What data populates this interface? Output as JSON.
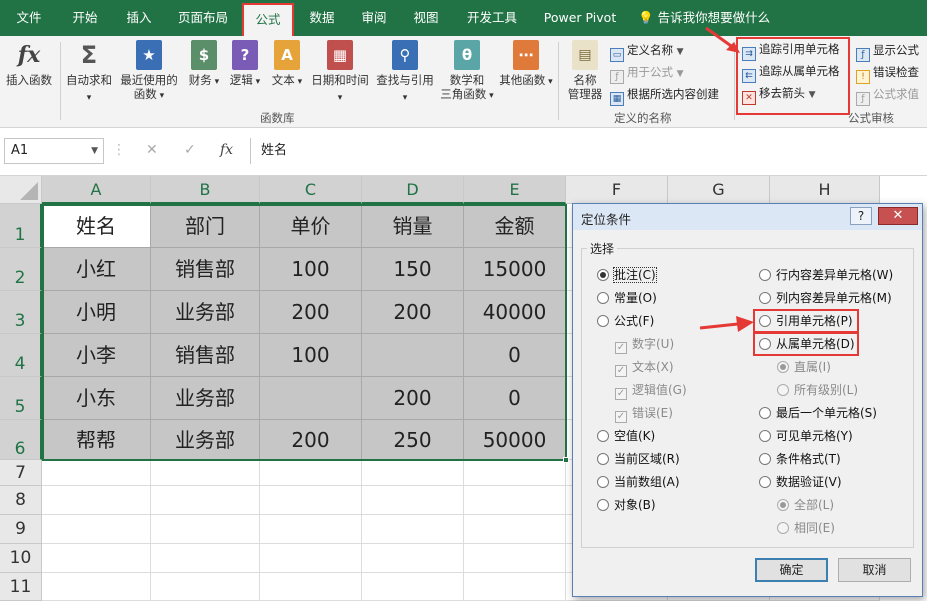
{
  "menu": {
    "tabs": [
      "文件",
      "开始",
      "插入",
      "页面布局",
      "公式",
      "数据",
      "审阅",
      "视图",
      "开发工具",
      "Power Pivot"
    ],
    "active_tab": "公式",
    "tell_me": "告诉我你想要做什么"
  },
  "ribbon": {
    "insert_function": "插入函数",
    "library": [
      {
        "line1": "自动求和",
        "line2": "",
        "icon": "Σ",
        "icon_name": "sum-icon",
        "color": "#555555"
      },
      {
        "line1": "最近使用的",
        "line2": "函数",
        "icon": "★",
        "icon_name": "star-book-icon",
        "color": "#3a6fb5"
      },
      {
        "line1": "财务",
        "line2": "",
        "icon": "$",
        "icon_name": "coins-book-icon",
        "color": "#5a8f6a"
      },
      {
        "line1": "逻辑",
        "line2": "",
        "icon": "?",
        "icon_name": "question-book-icon",
        "color": "#7a5bb5"
      },
      {
        "line1": "文本",
        "line2": "",
        "icon": "A",
        "icon_name": "text-book-icon",
        "color": "#e6a33a"
      },
      {
        "line1": "日期和时间",
        "line2": "",
        "icon": "▦",
        "icon_name": "calendar-book-icon",
        "color": "#c0504d"
      },
      {
        "line1": "查找与引用",
        "line2": "",
        "icon": "⚲",
        "icon_name": "search-book-icon",
        "color": "#3a6fb5"
      },
      {
        "line1": "数学和",
        "line2": "三角函数",
        "icon": "θ",
        "icon_name": "theta-book-icon",
        "color": "#5aa5a5"
      },
      {
        "line1": "其他函数",
        "line2": "",
        "icon": "⋯",
        "icon_name": "more-book-icon",
        "color": "#e07a3a"
      }
    ],
    "library_label": "函数库",
    "name_manager": [
      "名称",
      "管理器"
    ],
    "define_name": "定义名称",
    "use_in_formula": "用于公式",
    "create_from_selection": "根据所选内容创建",
    "names_label": "定义的名称",
    "trace_precedents": "追踪引用单元格",
    "trace_dependents": "追踪从属单元格",
    "remove_arrows": "移去箭头",
    "show_formulas": "显示公式",
    "error_checking": "错误检查",
    "evaluate_formula": "公式求值",
    "audit_label": "公式审核"
  },
  "formula_bar": {
    "name_box": "A1",
    "fx": "fx",
    "formula": "姓名"
  },
  "sheet": {
    "columns": [
      "A",
      "B",
      "C",
      "D",
      "E",
      "F",
      "G",
      "H"
    ],
    "rows": [
      "1",
      "2",
      "3",
      "4",
      "5",
      "6",
      "7",
      "8",
      "9",
      "10",
      "11"
    ],
    "cells": [
      [
        "姓名",
        "部门",
        "单价",
        "销量",
        "金额"
      ],
      [
        "小红",
        "销售部",
        "100",
        "150",
        "15000"
      ],
      [
        "小明",
        "业务部",
        "200",
        "200",
        "40000"
      ],
      [
        "小李",
        "销售部",
        "100",
        "",
        "0"
      ],
      [
        "小东",
        "业务部",
        "",
        "200",
        "0"
      ],
      [
        "帮帮",
        "业务部",
        "200",
        "250",
        "50000"
      ]
    ]
  },
  "dialog": {
    "title": "定位条件",
    "help": "?",
    "close": "✕",
    "group": "选择",
    "left_options": [
      {
        "label": "批注(C)",
        "kind": "radio",
        "checked": true,
        "disabled": false
      },
      {
        "label": "常量(O)",
        "kind": "radio",
        "checked": false,
        "disabled": false
      },
      {
        "label": "公式(F)",
        "kind": "radio",
        "checked": false,
        "disabled": false
      },
      {
        "label": "数字(U)",
        "kind": "check",
        "checked": true,
        "disabled": true
      },
      {
        "label": "文本(X)",
        "kind": "check",
        "checked": true,
        "disabled": true
      },
      {
        "label": "逻辑值(G)",
        "kind": "check",
        "checked": true,
        "disabled": true
      },
      {
        "label": "错误(E)",
        "kind": "check",
        "checked": true,
        "disabled": true
      },
      {
        "label": "空值(K)",
        "kind": "radio",
        "checked": false,
        "disabled": false
      },
      {
        "label": "当前区域(R)",
        "kind": "radio",
        "checked": false,
        "disabled": false
      },
      {
        "label": "当前数组(A)",
        "kind": "radio",
        "checked": false,
        "disabled": false
      },
      {
        "label": "对象(B)",
        "kind": "radio",
        "checked": false,
        "disabled": false
      }
    ],
    "right_options": [
      {
        "label": "行内容差异单元格(W)",
        "kind": "radio",
        "checked": false,
        "disabled": false
      },
      {
        "label": "列内容差异单元格(M)",
        "kind": "radio",
        "checked": false,
        "disabled": false
      },
      {
        "label": "引用单元格(P)",
        "kind": "radio",
        "checked": false,
        "disabled": false
      },
      {
        "label": "从属单元格(D)",
        "kind": "radio",
        "checked": false,
        "disabled": false
      },
      {
        "label": "直属(I)",
        "kind": "radio",
        "checked": true,
        "disabled": true
      },
      {
        "label": "所有级别(L)",
        "kind": "radio",
        "checked": false,
        "disabled": true
      },
      {
        "label": "最后一个单元格(S)",
        "kind": "radio",
        "checked": false,
        "disabled": false
      },
      {
        "label": "可见单元格(Y)",
        "kind": "radio",
        "checked": false,
        "disabled": false
      },
      {
        "label": "条件格式(T)",
        "kind": "radio",
        "checked": false,
        "disabled": false
      },
      {
        "label": "数据验证(V)",
        "kind": "radio",
        "checked": false,
        "disabled": false
      },
      {
        "label": "全部(L)",
        "kind": "radio",
        "checked": true,
        "disabled": true
      },
      {
        "label": "相同(E)",
        "kind": "radio",
        "checked": false,
        "disabled": true
      }
    ],
    "ok": "确定",
    "cancel": "取消"
  }
}
